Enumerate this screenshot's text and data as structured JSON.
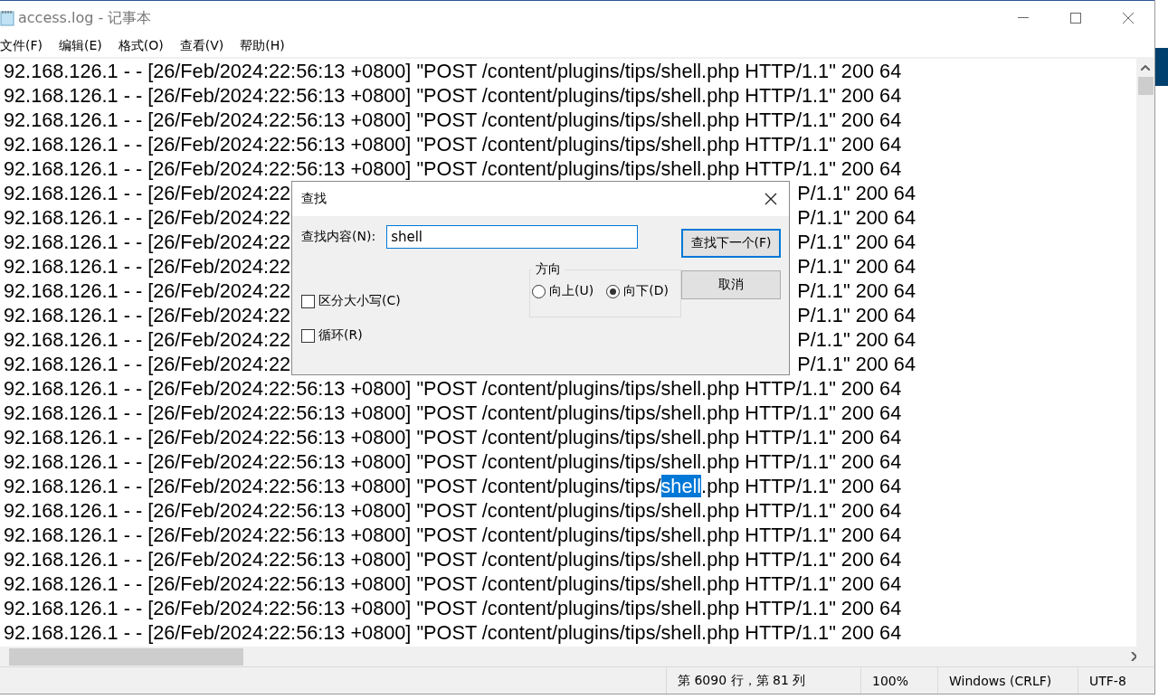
{
  "window": {
    "title": "access.log - 记事本"
  },
  "menu": [
    "文件(F)",
    "编辑(E)",
    "格式(O)",
    "查看(V)",
    "帮助(H)"
  ],
  "lines": [
    {
      "kind": "full",
      "text": "92.168.126.1 - - [26/Feb/2024:22:56:13 +0800] \"POST /content/plugins/tips/shell.php HTTP/1.1\" 200 64"
    },
    {
      "kind": "full",
      "text": "92.168.126.1 - - [26/Feb/2024:22:56:13 +0800] \"POST /content/plugins/tips/shell.php HTTP/1.1\" 200 64"
    },
    {
      "kind": "full",
      "text": "92.168.126.1 - - [26/Feb/2024:22:56:13 +0800] \"POST /content/plugins/tips/shell.php HTTP/1.1\" 200 64"
    },
    {
      "kind": "full",
      "text": "92.168.126.1 - - [26/Feb/2024:22:56:13 +0800] \"POST /content/plugins/tips/shell.php HTTP/1.1\" 200 64"
    },
    {
      "kind": "full",
      "text": "92.168.126.1 - - [26/Feb/2024:22:56:13 +0800] \"POST /content/plugins/tips/shell.php HTTP/1.1\" 200 64"
    },
    {
      "kind": "split",
      "left": "92.168.126.1 - - [26/Feb/2024:22",
      "right": "P/1.1\" 200 64"
    },
    {
      "kind": "split",
      "left": "92.168.126.1 - - [26/Feb/2024:22",
      "right": "P/1.1\" 200 64"
    },
    {
      "kind": "split",
      "left": "92.168.126.1 - - [26/Feb/2024:22",
      "right": "P/1.1\" 200 64"
    },
    {
      "kind": "split",
      "left": "92.168.126.1 - - [26/Feb/2024:22",
      "right": "P/1.1\" 200 64"
    },
    {
      "kind": "split",
      "left": "92.168.126.1 - - [26/Feb/2024:22",
      "right": "P/1.1\" 200 64"
    },
    {
      "kind": "split",
      "left": "92.168.126.1 - - [26/Feb/2024:22",
      "right": "P/1.1\" 200 64"
    },
    {
      "kind": "split",
      "left": "92.168.126.1 - - [26/Feb/2024:22",
      "right": "P/1.1\" 200 64"
    },
    {
      "kind": "split",
      "left": "92.168.126.1 - - [26/Feb/2024:22",
      "right": "P/1.1\" 200 64"
    },
    {
      "kind": "full",
      "text": "92.168.126.1 - - [26/Feb/2024:22:56:13 +0800] \"POST /content/plugins/tips/shell.php HTTP/1.1\" 200 64"
    },
    {
      "kind": "full",
      "text": "92.168.126.1 - - [26/Feb/2024:22:56:13 +0800] \"POST /content/plugins/tips/shell.php HTTP/1.1\" 200 64"
    },
    {
      "kind": "full",
      "text": "92.168.126.1 - - [26/Feb/2024:22:56:13 +0800] \"POST /content/plugins/tips/shell.php HTTP/1.1\" 200 64"
    },
    {
      "kind": "full",
      "text": "92.168.126.1 - - [26/Feb/2024:22:56:13 +0800] \"POST /content/plugins/tips/shell.php HTTP/1.1\" 200 64"
    },
    {
      "kind": "selection",
      "before": "92.168.126.1 - - [26/Feb/2024:22:56:13 +0800] \"POST /content/plugins/tips/",
      "selected_text": "shell",
      "after": ".php HTTP/1.1\" 200 64"
    },
    {
      "kind": "full",
      "text": "92.168.126.1 - - [26/Feb/2024:22:56:13 +0800] \"POST /content/plugins/tips/shell.php HTTP/1.1\" 200 64"
    },
    {
      "kind": "full",
      "text": "92.168.126.1 - - [26/Feb/2024:22:56:13 +0800] \"POST /content/plugins/tips/shell.php HTTP/1.1\" 200 64"
    },
    {
      "kind": "full",
      "text": "92.168.126.1 - - [26/Feb/2024:22:56:13 +0800] \"POST /content/plugins/tips/shell.php HTTP/1.1\" 200 64"
    },
    {
      "kind": "full",
      "text": "92.168.126.1 - - [26/Feb/2024:22:56:13 +0800] \"POST /content/plugins/tips/shell.php HTTP/1.1\" 200 64"
    },
    {
      "kind": "full",
      "text": "92.168.126.1 - - [26/Feb/2024:22:56:13 +0800] \"POST /content/plugins/tips/shell.php HTTP/1.1\" 200 64"
    },
    {
      "kind": "full",
      "text": "92.168.126.1 - - [26/Feb/2024:22:56:13 +0800] \"POST /content/plugins/tips/shell.php HTTP/1.1\" 200 64"
    }
  ],
  "find_dialog": {
    "title": "查找",
    "field_label": "查找内容(N):",
    "field_value": "shell",
    "checkboxes": [
      {
        "label": "区分大小写(C)",
        "checked": false
      },
      {
        "label": "循环(R)",
        "checked": false
      }
    ],
    "direction": {
      "label": "方向",
      "options": [
        {
          "label": "向上(U)",
          "selected": false
        },
        {
          "label": "向下(D)",
          "selected": true
        }
      ]
    },
    "buttons": [
      {
        "label": "查找下一个(F)",
        "default": true
      },
      {
        "label": "取消",
        "default": false
      }
    ]
  },
  "status_bar": [
    "第 6090 行，第 81 列",
    "100%",
    "Windows (CRLF)",
    "UTF-8"
  ]
}
